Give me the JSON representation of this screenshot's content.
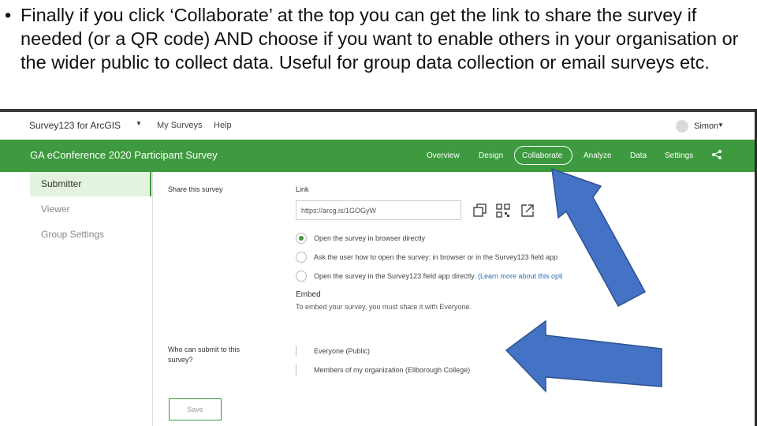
{
  "slide": {
    "bullet": "•",
    "text": "Finally if you click ‘Collaborate’ at the top you can get the link to share the survey if needed (or a QR code) AND choose if you want to enable others in your organisation or the wider public to collect data. Useful for group data collection or email surveys etc."
  },
  "app": {
    "brand": "Survey123 for ArcGIS",
    "nav": [
      "My Surveys",
      "Help"
    ],
    "user": "Simon",
    "survey_title": "GA eConference 2020 Participant Survey",
    "tabs": [
      "Overview",
      "Design",
      "Collaborate",
      "Analyze",
      "Data",
      "Settings"
    ],
    "active_tab": "Collaborate"
  },
  "sidebar": {
    "items": [
      {
        "label": "Submitter",
        "active": true
      },
      {
        "label": "Viewer",
        "active": false
      },
      {
        "label": "Group Settings",
        "active": false
      }
    ]
  },
  "share": {
    "section_label": "Share this survey",
    "link_label": "Link",
    "link_value": "https://arcg.is/1GOGyW",
    "options": [
      {
        "text": "Open the survey in browser directly",
        "checked": true
      },
      {
        "text": "Ask the user how to open the survey: in browser or in the Survey123 field app",
        "checked": false
      },
      {
        "text": "Open the survey in the Survey123 field app directly.",
        "link": "(Learn more about this opti",
        "checked": false
      }
    ],
    "embed_label": "Embed",
    "embed_text": "To embed your survey, you must share it with Everyone."
  },
  "submit": {
    "label": "Who can submit to this survey?",
    "options": [
      "Everyone (Public)",
      "Members of my organization (Ellborough College)"
    ],
    "save_label": "Save"
  },
  "colors": {
    "green": "#3d9a3e",
    "arrow_fill": "#4472c4",
    "arrow_stroke": "#2f528f"
  }
}
